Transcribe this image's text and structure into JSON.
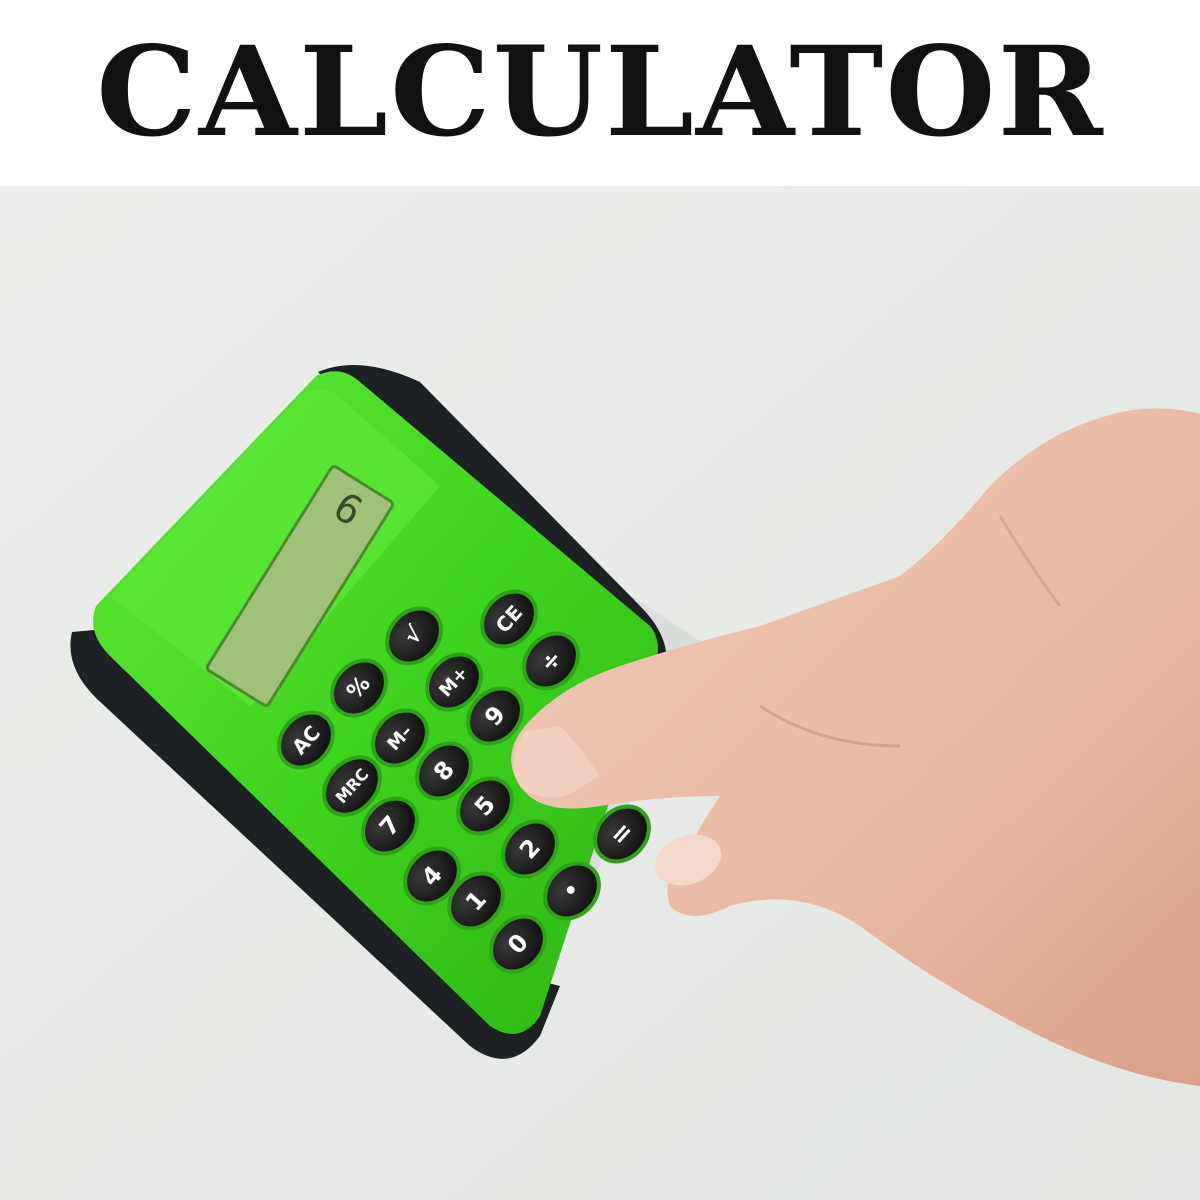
{
  "title": "CALCULATOR",
  "colors": {
    "title": "#111111",
    "background": "#e9ebe8",
    "calculator_green": "#3fd41f",
    "rubber": "#1e2123",
    "key": "#141414",
    "skin": "#e8b9a4"
  },
  "calculator": {
    "display_value": "6",
    "keys": {
      "ce": "CE",
      "sqrt": "√",
      "divide": "÷",
      "percent": "%",
      "m_plus": "M+",
      "nine": "9",
      "ac": "AC",
      "m_minus": "M–",
      "mrc": "MRC",
      "eight": "8",
      "five": "5",
      "seven": "7",
      "two": "2",
      "equals": "=",
      "four": "4",
      "one": "1",
      "dot": "•",
      "zero": "0"
    }
  }
}
